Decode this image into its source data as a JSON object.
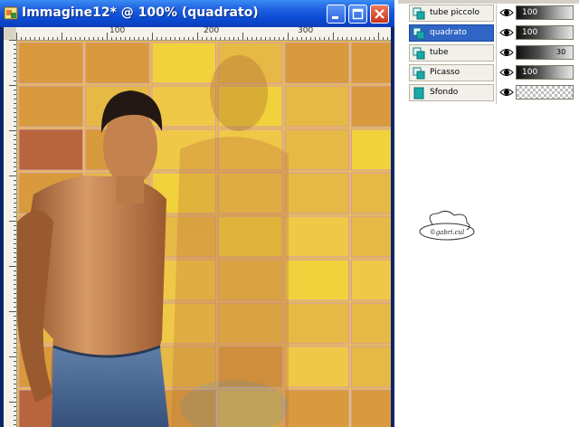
{
  "window": {
    "title": "Immagine12* @ 100% (quadrato)",
    "buttons": [
      "minimize",
      "maximize",
      "close"
    ]
  },
  "ruler": {
    "labels": [
      "100",
      "200",
      "300"
    ]
  },
  "canvas": {
    "content": "photo of a shirtless man in jeans in front of a yellow/orange tile grid"
  },
  "layers": [
    {
      "name": "tube piccolo",
      "selected": false,
      "icon": "layer-icon",
      "opacity": "100",
      "extra": ""
    },
    {
      "name": "quadrato",
      "selected": true,
      "icon": "layer-icon",
      "opacity": "100",
      "extra": ""
    },
    {
      "name": "tube",
      "selected": false,
      "icon": "layer-icon",
      "opacity": "",
      "extra": "30"
    },
    {
      "name": "Picasso",
      "selected": false,
      "icon": "layer-icon",
      "opacity": "100",
      "extra": ""
    },
    {
      "name": "Sfondo",
      "selected": false,
      "icon": "background-layer-icon",
      "opacity": "",
      "extra": ""
    }
  ],
  "watermark_text": "©gabri.cul",
  "colors": {
    "title_bar": "#1f5fe0",
    "selected_layer": "#3165c5",
    "tile_yellow": "#f2d23c",
    "tile_orange": "#d89a3c",
    "tile_red": "#b8643c"
  }
}
